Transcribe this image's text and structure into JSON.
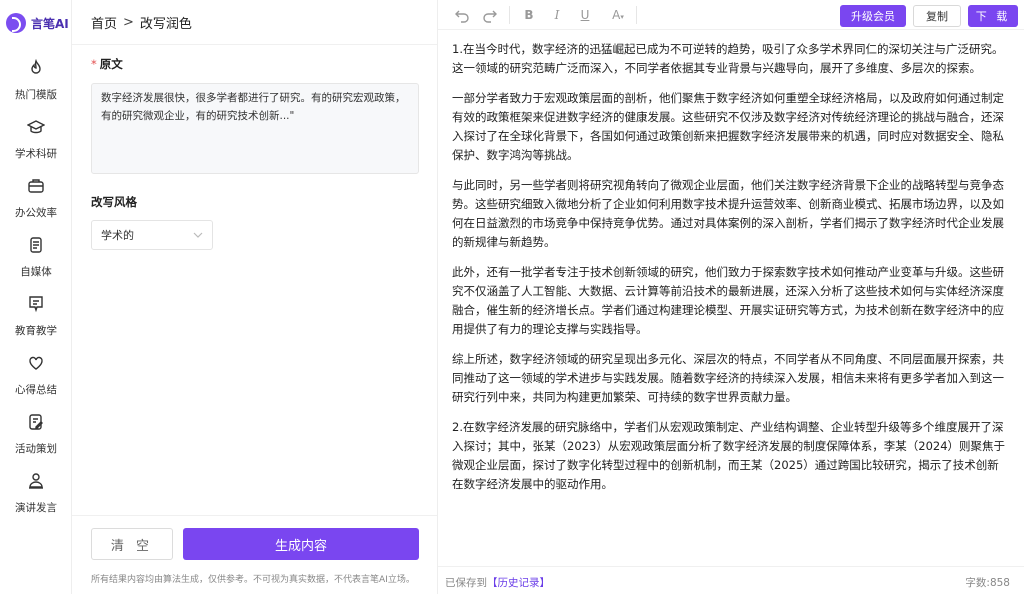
{
  "app": {
    "name": "言笔AI",
    "accent": "#7a46f0"
  },
  "sidebar": {
    "items": [
      {
        "label": "热门模版",
        "icon": "fire-icon"
      },
      {
        "label": "学术科研",
        "icon": "graduation-cap-icon"
      },
      {
        "label": "办公效率",
        "icon": "briefcase-icon"
      },
      {
        "label": "自媒体",
        "icon": "document-icon"
      },
      {
        "label": "教育教学",
        "icon": "chat-board-icon"
      },
      {
        "label": "心得总结",
        "icon": "heart-icon"
      },
      {
        "label": "活动策划",
        "icon": "edit-note-icon"
      },
      {
        "label": "演讲发言",
        "icon": "speaker-icon"
      }
    ]
  },
  "breadcrumb": {
    "home": "首页",
    "separator": ">",
    "current": "改写润色"
  },
  "form": {
    "source_label": "原文",
    "source_text": "数字经济发展很快，很多学者都进行了研究。有的研究宏观政策，有的研究微观企业，有的研究技术创新...\"",
    "style_label": "改写风格",
    "style_value": "学术的",
    "clear_button": "清 空",
    "generate_button": "生成内容",
    "disclaimer": "所有结果内容均由算法生成，仅供参考。不可视为真实数据，不代表言笔AI立场。"
  },
  "toolbar": {
    "upgrade": "升级会员",
    "copy": "复制",
    "download": "下 载"
  },
  "output": {
    "paragraphs": [
      "1.在当今时代，数字经济的迅猛崛起已成为不可逆转的趋势，吸引了众多学术界同仁的深切关注与广泛研究。这一领域的研究范畴广泛而深入，不同学者依据其专业背景与兴趣导向，展开了多维度、多层次的探索。",
      "一部分学者致力于宏观政策层面的剖析，他们聚焦于数字经济如何重塑全球经济格局，以及政府如何通过制定有效的政策框架来促进数字经济的健康发展。这些研究不仅涉及数字经济对传统经济理论的挑战与融合，还深入探讨了在全球化背景下，各国如何通过政策创新来把握数字经济发展带来的机遇，同时应对数据安全、隐私保护、数字鸿沟等挑战。",
      "与此同时，另一些学者则将研究视角转向了微观企业层面，他们关注数字经济背景下企业的战略转型与竞争态势。这些研究细致入微地分析了企业如何利用数字技术提升运营效率、创新商业模式、拓展市场边界，以及如何在日益激烈的市场竞争中保持竞争优势。通过对具体案例的深入剖析，学者们揭示了数字经济时代企业发展的新规律与新趋势。",
      "此外，还有一批学者专注于技术创新领域的研究，他们致力于探索数字技术如何推动产业变革与升级。这些研究不仅涵盖了人工智能、大数据、云计算等前沿技术的最新进展，还深入分析了这些技术如何与实体经济深度融合，催生新的经济增长点。学者们通过构建理论模型、开展实证研究等方式，为技术创新在数字经济中的应用提供了有力的理论支撑与实践指导。",
      "综上所述，数字经济领域的研究呈现出多元化、深层次的特点，不同学者从不同角度、不同层面展开探索，共同推动了这一领域的学术进步与实践发展。随着数字经济的持续深入发展，相信未来将有更多学者加入到这一研究行列中来，共同为构建更加繁荣、可持续的数字世界贡献力量。",
      "2.在数字经济发展的研究脉络中，学者们从宏观政策制定、产业结构调整、企业转型升级等多个维度展开了深入探讨；其中，张某（2023）从宏观政策层面分析了数字经济发展的制度保障体系，李某（2024）则聚焦于微观企业层面，探讨了数字化转型过程中的创新机制，而王某（2025）通过跨国比较研究，揭示了技术创新在数字经济发展中的驱动作用。"
    ]
  },
  "status": {
    "saved_prefix": "已保存到",
    "history_link": "【历史记录】",
    "word_count": "字数:858"
  }
}
